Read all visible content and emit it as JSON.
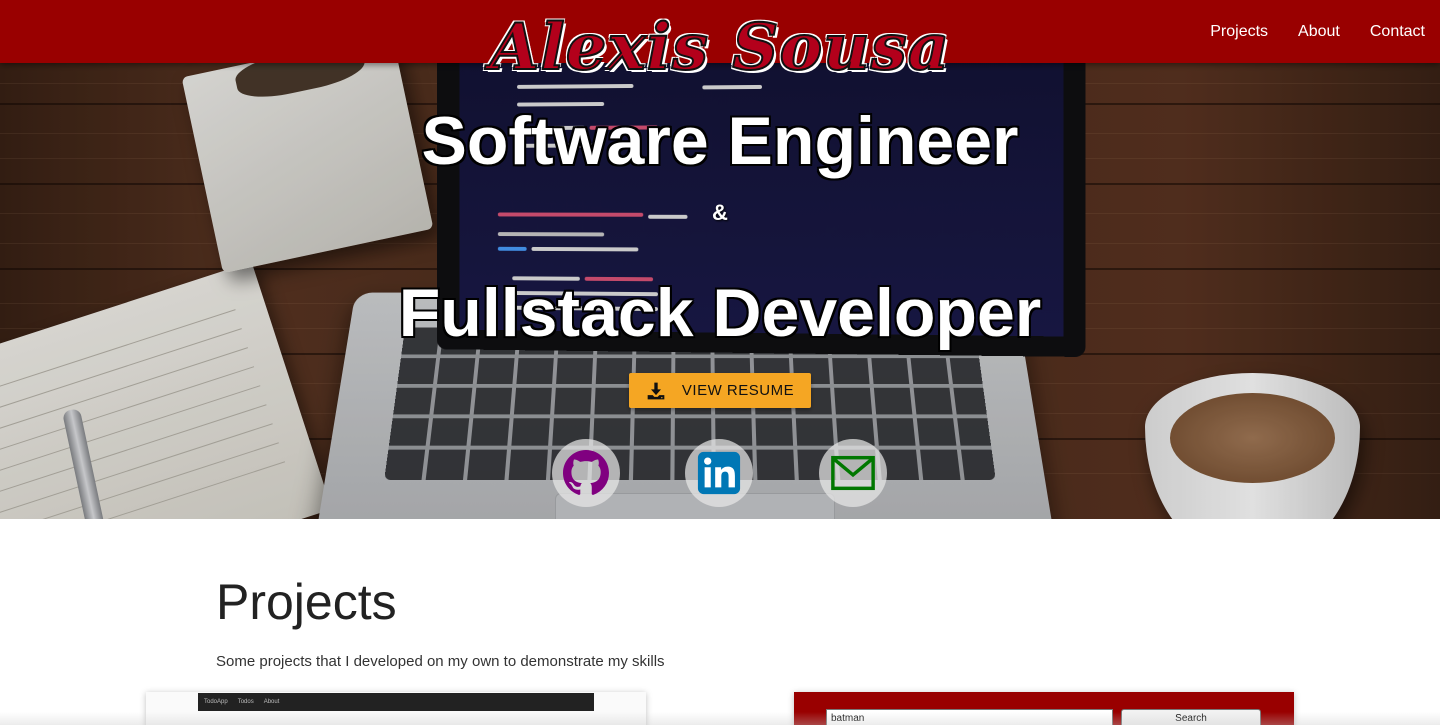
{
  "navbar": {
    "brand": "Alexis Sousa",
    "links": [
      "Projects",
      "About",
      "Contact"
    ],
    "background": "#990000"
  },
  "hero": {
    "title_line1": "Software Engineer",
    "ampersand": "&",
    "title_line2": "Fullstack Developer",
    "resume_button": {
      "label": "VIEW RESUME",
      "icon": "download-icon",
      "color": "#f5a623"
    },
    "socials": [
      {
        "icon": "github-icon",
        "color": "#800080"
      },
      {
        "icon": "linkedin-icon",
        "color": "#0077b5"
      },
      {
        "icon": "envelope-icon",
        "color": "#007700"
      }
    ]
  },
  "projects": {
    "title": "Projects",
    "subtitle": "Some projects that I developed on my own to demonstrate my skills",
    "cards": [
      {
        "preview_nav": [
          "TodoApp",
          "Todos",
          "About"
        ]
      },
      {
        "search_value": "batman",
        "search_button": "Search"
      }
    ]
  }
}
